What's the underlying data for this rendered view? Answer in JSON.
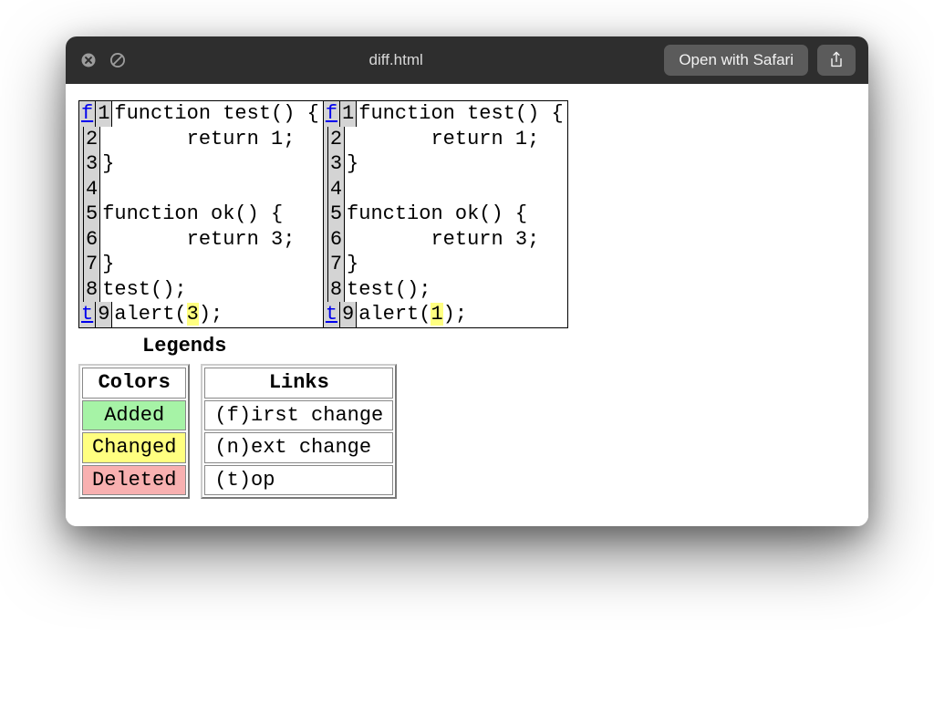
{
  "titlebar": {
    "title": "diff.html",
    "open_button": "Open with Safari"
  },
  "diff": {
    "left": {
      "rows": [
        {
          "link": "f",
          "num": "1",
          "code": "function test() {"
        },
        {
          "link": "",
          "num": "2",
          "code": "       return 1;"
        },
        {
          "link": "",
          "num": "3",
          "code": "}"
        },
        {
          "link": "",
          "num": "4",
          "code": ""
        },
        {
          "link": "",
          "num": "5",
          "code": "function ok() {"
        },
        {
          "link": "",
          "num": "6",
          "code": "       return 3;"
        },
        {
          "link": "",
          "num": "7",
          "code": "}"
        },
        {
          "link": "",
          "num": "8",
          "code": "test();"
        },
        {
          "link": "t",
          "num": "9",
          "code_pre": "alert(",
          "code_hl": "3",
          "code_post": ");"
        }
      ]
    },
    "right": {
      "rows": [
        {
          "link": "f",
          "num": "1",
          "code": "function test() {"
        },
        {
          "link": "",
          "num": "2",
          "code": "       return 1;"
        },
        {
          "link": "",
          "num": "3",
          "code": "}"
        },
        {
          "link": "",
          "num": "4",
          "code": ""
        },
        {
          "link": "",
          "num": "5",
          "code": "function ok() {"
        },
        {
          "link": "",
          "num": "6",
          "code": "       return 3;"
        },
        {
          "link": "",
          "num": "7",
          "code": "}"
        },
        {
          "link": "",
          "num": "8",
          "code": "test();"
        },
        {
          "link": "t",
          "num": "9",
          "code_pre": "alert(",
          "code_hl": "1",
          "code_post": ");"
        }
      ]
    }
  },
  "legends": {
    "title": "Legends",
    "colors": {
      "header": "Colors",
      "added": "Added",
      "changed": "Changed",
      "deleted": "Deleted"
    },
    "links": {
      "header": "Links",
      "first": "(f)irst change",
      "next": "(n)ext change",
      "top": "(t)op"
    }
  }
}
